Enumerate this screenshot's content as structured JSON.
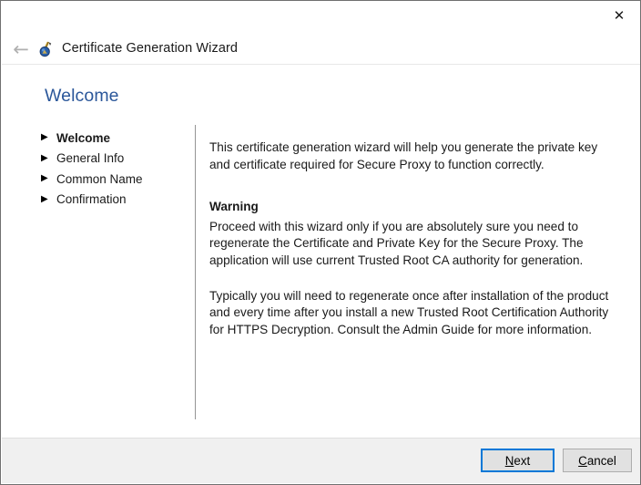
{
  "window": {
    "title": "Certificate Generation Wizard",
    "app_icon": "certificate-seal-icon",
    "close_label": "✕",
    "back_label": "←",
    "accent_color": "#2b579a",
    "focus_color": "#0078d7"
  },
  "page": {
    "heading": "Welcome"
  },
  "steps": [
    {
      "label": "Welcome",
      "marker": "▶",
      "current": true
    },
    {
      "label": "General Info",
      "marker": "▶",
      "current": false
    },
    {
      "label": "Common Name",
      "marker": "▶",
      "current": false
    },
    {
      "label": "Confirmation",
      "marker": "▶",
      "current": false
    }
  ],
  "content": {
    "intro": "This certificate generation wizard will help you generate the private key and certificate required for Secure Proxy to function correctly.",
    "warning_heading": "Warning",
    "warning_body": "Proceed with this wizard only if you are absolutely sure you need to regenerate the Certificate and Private Key for the Secure Proxy. The application will use current Trusted Root CA authority for generation.",
    "note": "Typically you will need to regenerate once after installation of the product and every time after you install a new Trusted Root Certification Authority for HTTPS Decryption. Consult the Admin Guide for more information."
  },
  "footer": {
    "next": {
      "prefix": "",
      "accel": "N",
      "suffix": "ext"
    },
    "cancel": {
      "prefix": "",
      "accel": "C",
      "suffix": "ancel"
    }
  }
}
